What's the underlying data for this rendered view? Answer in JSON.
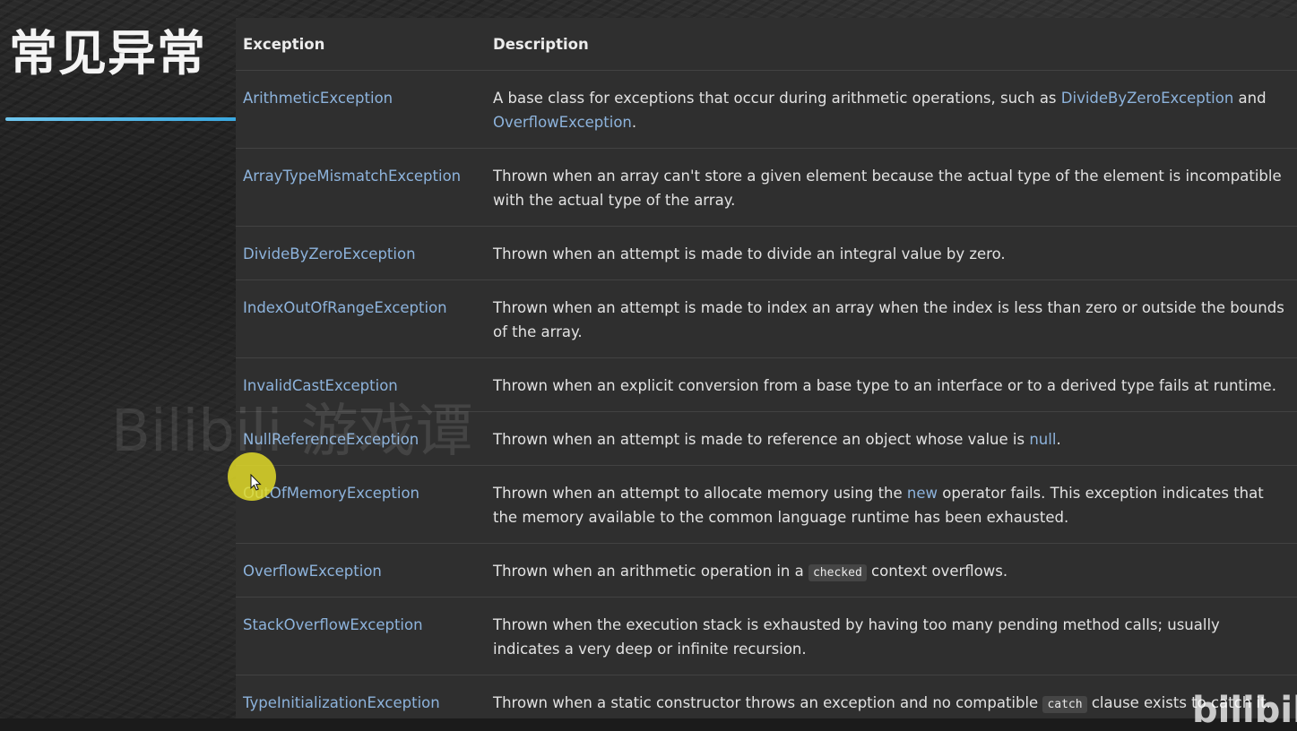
{
  "slide": {
    "title": "常见异常",
    "watermark": "Bilibili 游戏谭",
    "corner_mark": "bilibili"
  },
  "table": {
    "headers": {
      "exception": "Exception",
      "description": "Description"
    },
    "rows": [
      {
        "name": "ArithmeticException",
        "desc": [
          {
            "t": "A base class for exceptions that occur during arithmetic operations, such as "
          },
          {
            "t": "DivideByZeroException",
            "k": "link"
          },
          {
            "t": " and "
          },
          {
            "t": "OverflowException",
            "k": "link"
          },
          {
            "t": "."
          }
        ]
      },
      {
        "name": "ArrayTypeMismatchException",
        "desc": [
          {
            "t": "Thrown when an array can't store a given element because the actual type of the element is incompatible with the actual type of the array."
          }
        ]
      },
      {
        "name": "DivideByZeroException",
        "desc": [
          {
            "t": "Thrown when an attempt is made to divide an integral value by zero."
          }
        ]
      },
      {
        "name": "IndexOutOfRangeException",
        "desc": [
          {
            "t": "Thrown when an attempt is made to index an array when the index is less than zero or outside the bounds of the array."
          }
        ]
      },
      {
        "name": "InvalidCastException",
        "desc": [
          {
            "t": "Thrown when an explicit conversion from a base type to an interface or to a derived type fails at runtime."
          }
        ]
      },
      {
        "name": "NullReferenceException",
        "desc": [
          {
            "t": "Thrown when an attempt is made to reference an object whose value is "
          },
          {
            "t": "null",
            "k": "link"
          },
          {
            "t": "."
          }
        ]
      },
      {
        "name": "OutOfMemoryException",
        "desc": [
          {
            "t": "Thrown when an attempt to allocate memory using the "
          },
          {
            "t": "new",
            "k": "link"
          },
          {
            "t": " operator fails. This exception indicates that the memory available to the common language runtime has been exhausted."
          }
        ]
      },
      {
        "name": "OverflowException",
        "desc": [
          {
            "t": "Thrown when an arithmetic operation in a "
          },
          {
            "t": "checked",
            "k": "code"
          },
          {
            "t": " context overflows."
          }
        ]
      },
      {
        "name": "StackOverflowException",
        "desc": [
          {
            "t": "Thrown when the execution stack is exhausted by having too many pending method calls; usually indicates a very deep or infinite recursion."
          }
        ]
      },
      {
        "name": "TypeInitializationException",
        "desc": [
          {
            "t": "Thrown when a static constructor throws an exception and no compatible "
          },
          {
            "t": "catch",
            "k": "code"
          },
          {
            "t": " clause exists to catch it."
          }
        ]
      }
    ]
  },
  "colors": {
    "link": "#8db3dc",
    "accent_underline": "#4fb5e8",
    "cursor_highlight": "#e8e028"
  }
}
